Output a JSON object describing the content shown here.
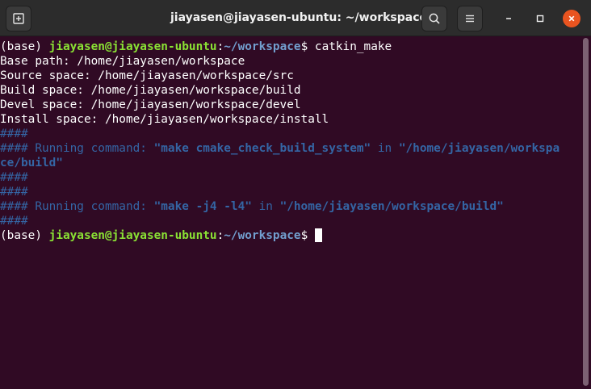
{
  "window": {
    "title": "jiayasen@jiayasen-ubuntu: ~/workspace",
    "new_tab_icon": "new-tab-icon",
    "search_icon": "search-icon",
    "menu_icon": "hamburger-menu-icon",
    "minimize_icon": "minimize-icon",
    "maximize_icon": "maximize-icon",
    "close_icon": "close-icon",
    "accent_color": "#e95420",
    "background_color": "#300a24"
  },
  "terminal": {
    "prompt1": {
      "env": "(base) ",
      "user_host": "jiayasen@jiayasen-ubuntu",
      "colon": ":",
      "path": "~/workspace",
      "symbol": "$ ",
      "command": "catkin_make"
    },
    "output": [
      "Base path: /home/jiayasen/workspace",
      "Source space: /home/jiayasen/workspace/src",
      "Build space: /home/jiayasen/workspace/build",
      "Devel space: /home/jiayasen/workspace/devel",
      "Install space: /home/jiayasen/workspace/install"
    ],
    "hashes": "####",
    "run1": {
      "prefix": "#### Running command: ",
      "command": "\"make cmake_check_build_system\"",
      "in": " in ",
      "dir_part1": "\"/home/jiayasen/workspa",
      "dir_part2": "ce/build\""
    },
    "run2": {
      "prefix": "#### Running command: ",
      "command": "\"make -j4 -l4\"",
      "in": " in ",
      "dir": "\"/home/jiayasen/workspace/build\""
    },
    "prompt2": {
      "env": "(base) ",
      "user_host": "jiayasen@jiayasen-ubuntu",
      "colon": ":",
      "path": "~/workspace",
      "symbol": "$ "
    }
  }
}
